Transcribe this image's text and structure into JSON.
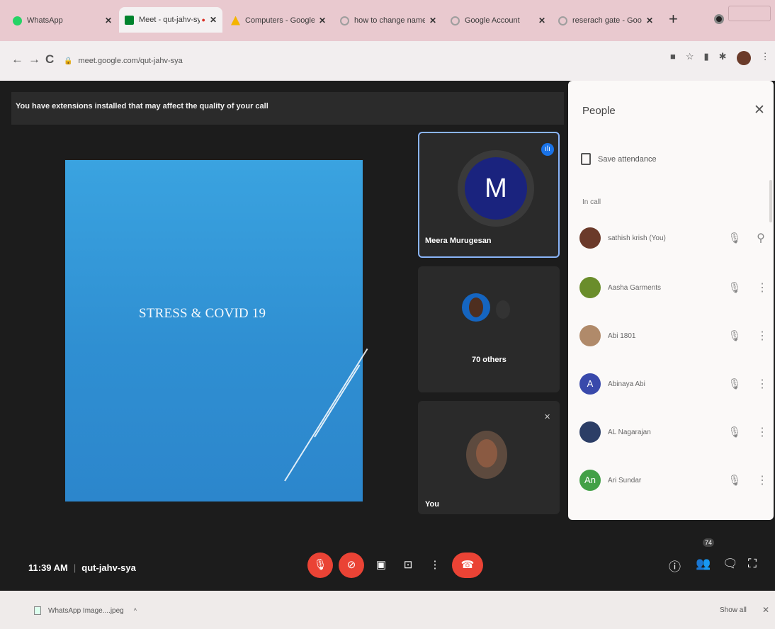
{
  "browser": {
    "tabs": [
      {
        "title": "WhatsApp",
        "color": "#25d366"
      },
      {
        "title": "Meet - qut-jahv-sya",
        "color": "#00832d"
      },
      {
        "title": "Computers - Google D",
        "color": "#f4b400"
      },
      {
        "title": "how to change name i",
        "color": "#9e9e9e"
      },
      {
        "title": "Google Account",
        "color": "#9e9e9e"
      },
      {
        "title": "reserach gate - Google",
        "color": "#9e9e9e"
      }
    ],
    "url": "meet.google.com/qut-jahv-sya"
  },
  "meet": {
    "banner": "You have extensions installed that may affect the quality of your call",
    "slide_title": "STRESS & COVID 19",
    "tiles": {
      "speaker_initial": "M",
      "speaker_name": "Meera Murugesan",
      "others_label": "70 others",
      "self_label": "You"
    },
    "clock": "11:39 AM",
    "meeting_code": "qut-jahv-sya",
    "participant_count": "74"
  },
  "people": {
    "title": "People",
    "save_attendance": "Save attendance",
    "in_call": "In call",
    "participants": [
      {
        "name": "sathish krish (You)",
        "initial": "",
        "color": "#6b3a2a"
      },
      {
        "name": "Aasha Garments",
        "initial": "",
        "color": "#6a8d2b"
      },
      {
        "name": "Abi 1801",
        "initial": "",
        "color": "#b08a6a"
      },
      {
        "name": "Abinaya Abi",
        "initial": "A",
        "color": "#3949ab"
      },
      {
        "name": "AL Nagarajan",
        "initial": "",
        "color": "#2c3e66"
      },
      {
        "name": "Ari Sundar",
        "initial": "An",
        "color": "#43a047"
      }
    ]
  },
  "shelf": {
    "download": "WhatsApp Image....jpeg",
    "show_all": "Show all"
  }
}
